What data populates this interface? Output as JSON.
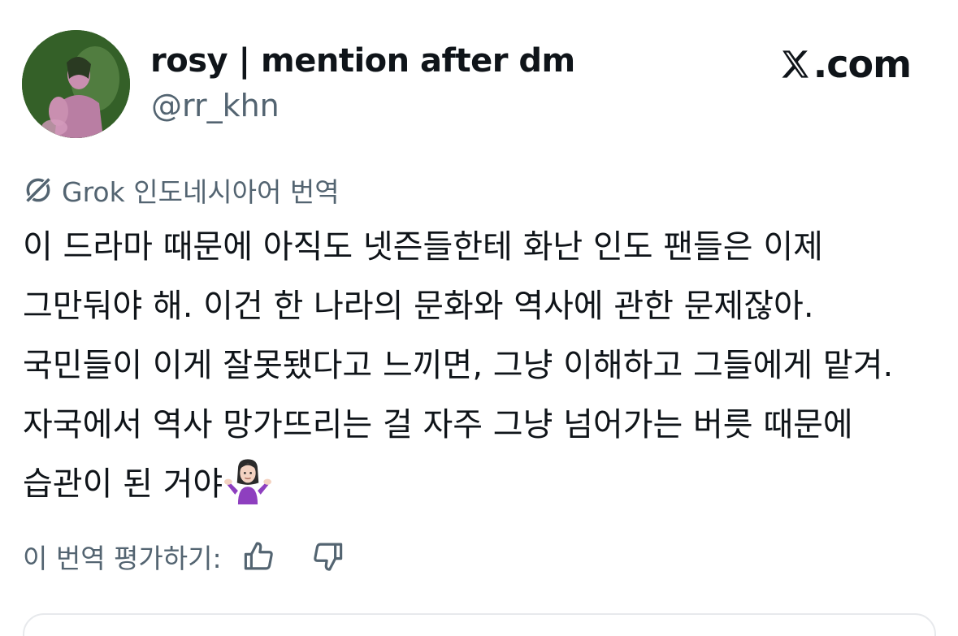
{
  "author": {
    "display_name": "rosy | mention after dm",
    "handle": "@rr_khn"
  },
  "brand": {
    "text": ".com"
  },
  "translation": {
    "label": "Grok 인도네시아어 번역"
  },
  "tweet": {
    "text": "이 드라마 때문에 아직도 넷즌들한테 화난 인도 팬들은 이제 그만둬야 해. 이건 한 나라의 문화와 역사에 관한 문제잖아. 국민들이 이게 잘못됐다고 느끼면, 그냥 이해하고 그들에게 맡겨. 자국에서 역사 망가뜨리는 걸 자주 그냥 넘어가는 버릇 때문에 습관이 된 거야",
    "emoji": "person-shrugging"
  },
  "rating": {
    "label": "이 번역 평가하기:"
  },
  "icons": {
    "grok": "grok-icon",
    "x_logo": "x-logo-icon",
    "thumbs_up": "thumbs-up-icon",
    "thumbs_down": "thumbs-down-icon"
  },
  "colors": {
    "text_primary": "#0f1419",
    "text_secondary": "#536471",
    "avatar_bg": "#3a5f2c",
    "emoji_shirt": "#8e3fbf"
  }
}
